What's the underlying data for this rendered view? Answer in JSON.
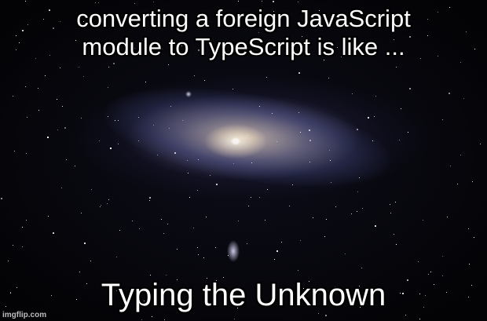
{
  "meme": {
    "top_text": [
      "converting a foreign JavaScript",
      "module to TypeScript is like ..."
    ],
    "bottom_text": "Typing the Unknown",
    "watermark": "imgflip.com"
  }
}
